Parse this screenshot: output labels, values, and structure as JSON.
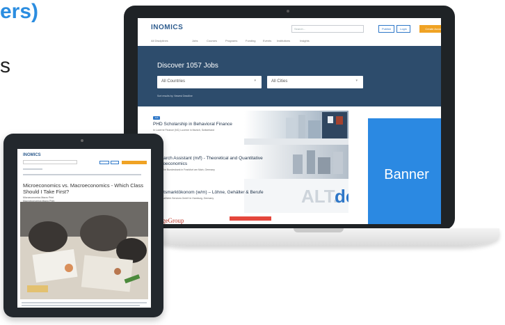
{
  "headline": {
    "text": "ers)",
    "glyph": "s"
  },
  "laptop": {
    "logo": "INOMICS",
    "search_placeholder": "Search...",
    "buttons": {
      "publish": "Publish",
      "login": "Login",
      "create": "Create Account"
    },
    "nav": [
      "All Disciplines",
      "Jobs",
      "Courses",
      "Programs",
      "Funding",
      "Events",
      "Institutions",
      "Insights"
    ],
    "hero_title": "Discover 1057 Jobs",
    "country_select": "All Countries",
    "city_select": "All Cities",
    "sort_row": "Sort results by:  Newest  Deadline",
    "listings": [
      {
        "tag": "Job",
        "title": "PHD Scholarship in Behavioral Finance",
        "sub": "In Lucerne Finance (NC) Lucerne in Munich, Switzerland"
      },
      {
        "tag": "Job",
        "title": "Research Assistant (m/f) - Theoretical and Quantitative Macroeconomics",
        "sub": "At Deutsche Bundesbank in Frankfurt am Main, Germany"
      },
      {
        "tag": "Job",
        "title": "Arbeitsmarktökonom (w/m) – Löhne, Gehälter & Berufe",
        "sub": "At PersonalWerk Services GmbH in Hamburg, Germany"
      }
    ],
    "partial_listing_text": "PageGroup",
    "banner_text": "Banner",
    "colors": {
      "navy": "#2d4c6c",
      "accent": "#2b89e2",
      "orange": "#f0a324"
    }
  },
  "tablet": {
    "logo": "INOMICS",
    "article_title": "Microeconomics vs. Macroeconomics - Which Class Should I Take First?",
    "meta_1": "Microeconomics   Macro Print",
    "meta_2": "Macroeconomics   Macro Print"
  }
}
